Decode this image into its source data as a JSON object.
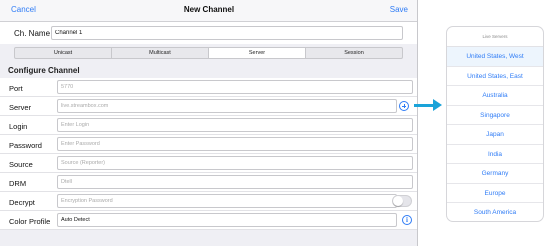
{
  "navbar": {
    "cancel": "Cancel",
    "title": "New Channel",
    "save": "Save"
  },
  "channel_name": {
    "label": "Ch. Name",
    "value": "Channel 1"
  },
  "segments": [
    "Unicast",
    "Multicast",
    "Server",
    "Session"
  ],
  "active_segment": "Server",
  "section_title": "Configure Channel",
  "fields": {
    "port": {
      "label": "Port",
      "placeholder": "5770"
    },
    "server": {
      "label": "Server",
      "placeholder": "live.streambox.com"
    },
    "login": {
      "label": "Login",
      "placeholder": "Enter Login"
    },
    "password": {
      "label": "Password",
      "placeholder": "Enter Password"
    },
    "source": {
      "label": "Source",
      "placeholder": "Source (Reporter)"
    },
    "drm": {
      "label": "DRM",
      "placeholder": "Dtell"
    },
    "decrypt": {
      "label": "Decrypt",
      "placeholder": "Encryption Password"
    },
    "color_profile": {
      "label": "Color Profile",
      "value": "Auto Detect"
    }
  },
  "server_list": {
    "title": "Live Servers",
    "items": [
      "United States, West",
      "United States, East",
      "Australia",
      "Singapore",
      "Japan",
      "India",
      "Germany",
      "Europe",
      "South America"
    ]
  },
  "colors": {
    "accent": "#2f7cf6",
    "arrow": "#1aa3d9"
  },
  "icons": {
    "add": "add-circle-icon",
    "info": "info-icon",
    "arrow": "right-arrow-icon"
  }
}
